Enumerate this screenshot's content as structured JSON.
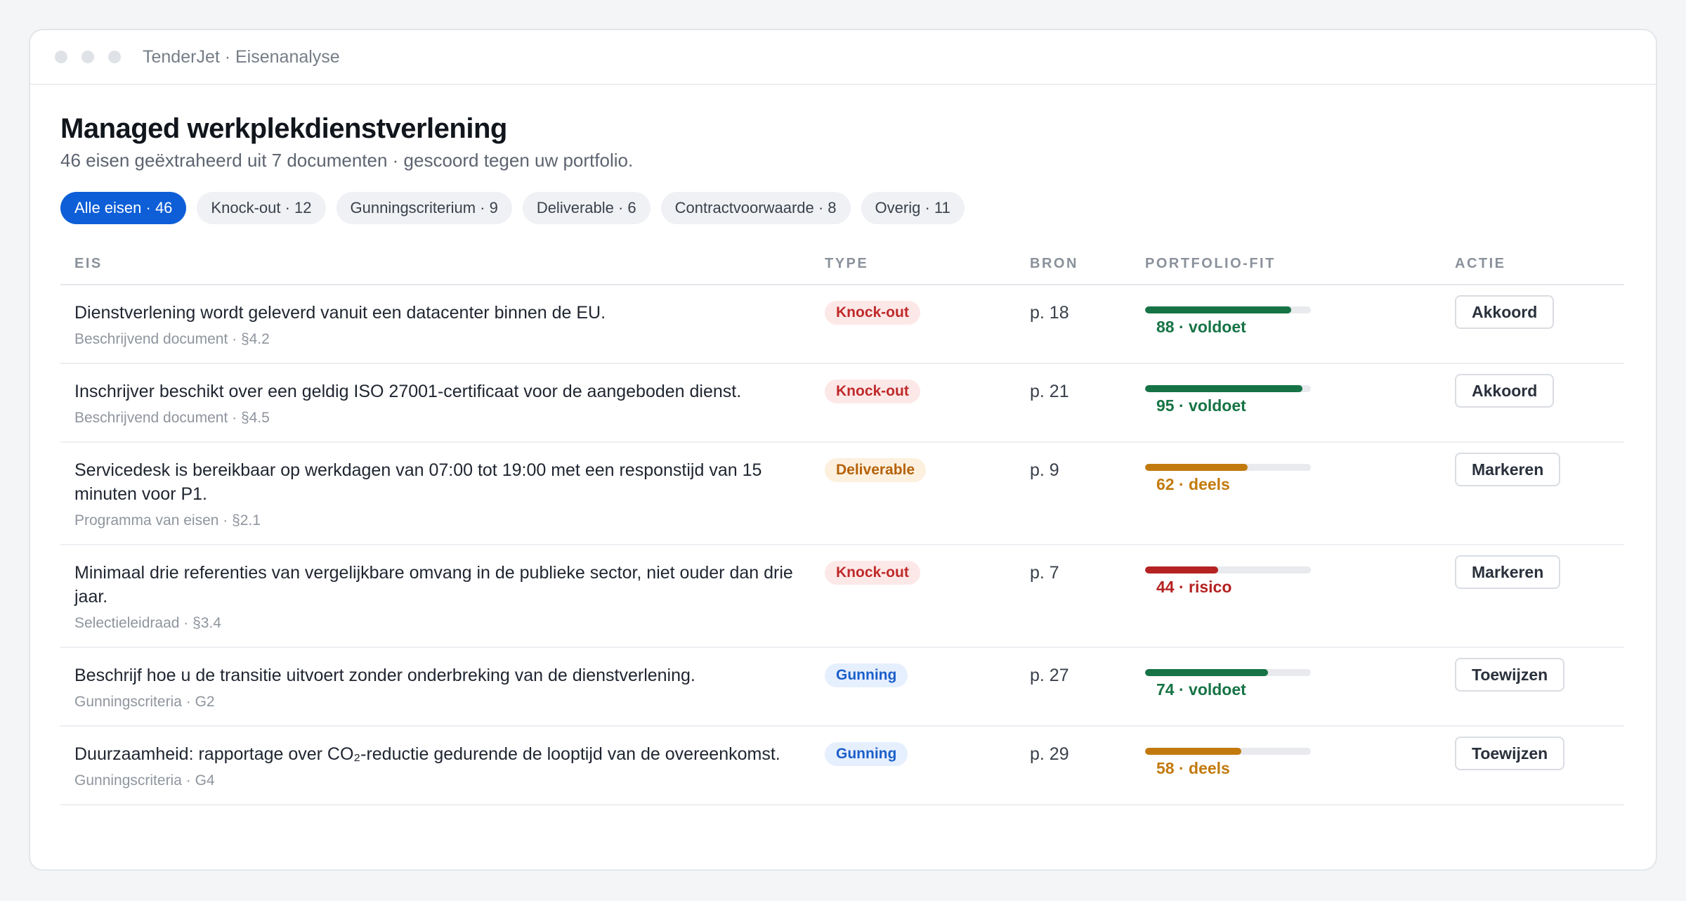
{
  "window": {
    "title": "TenderJet · Eisenanalyse"
  },
  "page": {
    "title": "Managed werkplekdienstverlening",
    "subtitle": "46 eisen geëxtraheerd uit 7 documenten · gescoord tegen uw portfolio."
  },
  "filters": [
    {
      "label": "Alle eisen · 46",
      "active": true
    },
    {
      "label": "Knock-out · 12",
      "active": false
    },
    {
      "label": "Gunningscriterium · 9",
      "active": false
    },
    {
      "label": "Deliverable · 6",
      "active": false
    },
    {
      "label": "Contractvoorwaarde · 8",
      "active": false
    },
    {
      "label": "Overig · 11",
      "active": false
    }
  ],
  "table": {
    "headers": {
      "eis": "EIS",
      "type": "TYPE",
      "bron": "BRON",
      "fit": "PORTFOLIO-FIT",
      "actie": "ACTIE"
    },
    "rows": [
      {
        "text": "Dienstverlening wordt geleverd vanuit een datacenter binnen de EU.",
        "source": "Beschrijvend document · §4.2",
        "type": "Knock-out",
        "type_kind": "ko",
        "bron": "p. 18",
        "score": 88,
        "fit_label": "88 · voldoet",
        "fit_kind": "ok",
        "action": "Akkoord"
      },
      {
        "text": "Inschrijver beschikt over een geldig ISO 27001-certificaat voor de aangeboden dienst.",
        "source": "Beschrijvend document · §4.5",
        "type": "Knock-out",
        "type_kind": "ko",
        "bron": "p. 21",
        "score": 95,
        "fit_label": "95 · voldoet",
        "fit_kind": "ok",
        "action": "Akkoord"
      },
      {
        "text": "Servicedesk is bereikbaar op werkdagen van 07:00 tot 19:00 met een responstijd van 15 minuten voor P1.",
        "source": "Programma van eisen · §2.1",
        "type": "Deliverable",
        "type_kind": "dl",
        "bron": "p. 9",
        "score": 62,
        "fit_label": "62 · deels",
        "fit_kind": "mid",
        "action": "Markeren"
      },
      {
        "text": "Minimaal drie referenties van vergelijkbare omvang in de publieke sector, niet ouder dan drie jaar.",
        "source": "Selectieleidraad · §3.4",
        "type": "Knock-out",
        "type_kind": "ko",
        "bron": "p. 7",
        "score": 44,
        "fit_label": "44 · risico",
        "fit_kind": "risk",
        "action": "Markeren"
      },
      {
        "text": "Beschrijf hoe u de transitie uitvoert zonder onderbreking van de dienstverlening.",
        "source": "Gunningscriteria · G2",
        "type": "Gunning",
        "type_kind": "gn",
        "bron": "p. 27",
        "score": 74,
        "fit_label": "74 · voldoet",
        "fit_kind": "ok",
        "action": "Toewijzen"
      },
      {
        "text": "Duurzaamheid: rapportage over CO₂-reductie gedurende de looptijd van de overeenkomst.",
        "source": "Gunningscriteria · G4",
        "type": "Gunning",
        "type_kind": "gn",
        "bron": "p. 29",
        "score": 58,
        "fit_label": "58 · deels",
        "fit_kind": "mid",
        "action": "Toewijzen"
      }
    ]
  },
  "colors": {
    "accent": "#0d5ed7",
    "ok": "#167345",
    "partial": "#c27a0e",
    "risk": "#b52222"
  }
}
